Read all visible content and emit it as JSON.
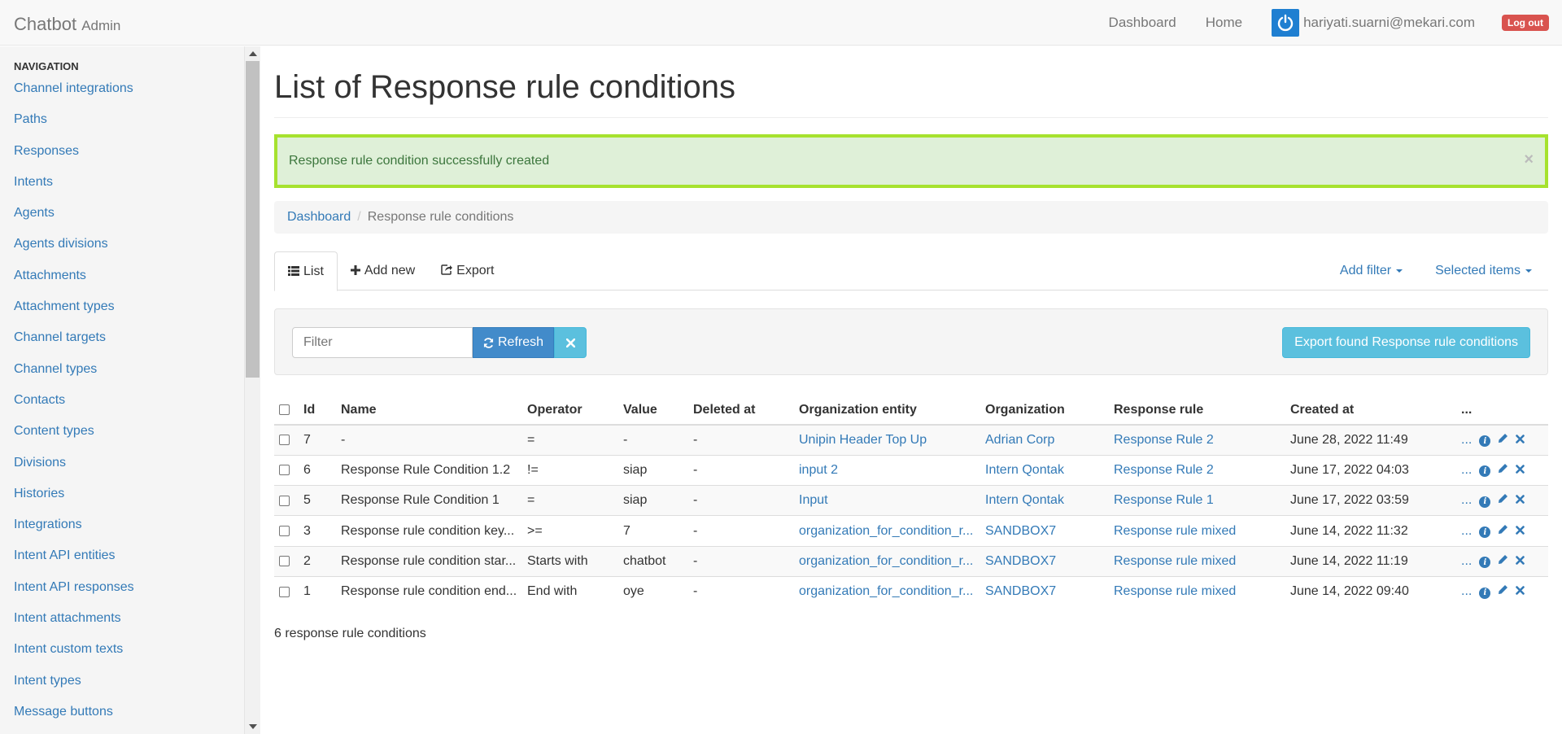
{
  "navbar": {
    "brand": "Chatbot",
    "brand_sub": "Admin",
    "links": [
      "Dashboard",
      "Home"
    ],
    "user_email": "hariyati.suarni@mekari.com",
    "logout_label": "Log out"
  },
  "sidebar": {
    "header": "NAVIGATION",
    "items": [
      "Channel integrations",
      "Paths",
      "Responses",
      "Intents",
      "Agents",
      "Agents divisions",
      "Attachments",
      "Attachment types",
      "Channel targets",
      "Channel types",
      "Contacts",
      "Content types",
      "Divisions",
      "Histories",
      "Integrations",
      "Intent API entities",
      "Intent API responses",
      "Intent attachments",
      "Intent custom texts",
      "Intent types",
      "Message buttons"
    ]
  },
  "page": {
    "title": "List of Response rule conditions",
    "alert": "Response rule condition successfully created",
    "alert_close": "×",
    "breadcrumb": [
      "Dashboard",
      "Response rule conditions"
    ],
    "breadcrumb_sep": "/",
    "tabs": [
      "List",
      "Add new",
      "Export"
    ],
    "add_filter": "Add filter",
    "selected_items": "Selected items",
    "filter_placeholder": "Filter",
    "refresh_label": "Refresh",
    "export_found_label": "Export found Response rule conditions",
    "footer_count": "6 response rule conditions"
  },
  "table": {
    "headers": [
      "Id",
      "Name",
      "Operator",
      "Value",
      "Deleted at",
      "Organization entity",
      "Organization",
      "Response rule",
      "Created at",
      "..."
    ],
    "rows": [
      {
        "id": "7",
        "name": "-",
        "operator": "=",
        "value": "-",
        "deleted_at": "-",
        "org_entity": "Unipin Header Top Up",
        "organization": "Adrian Corp",
        "response_rule": "Response Rule 2",
        "created_at": "June 28, 2022 11:49",
        "more": "..."
      },
      {
        "id": "6",
        "name": "Response Rule Condition 1.2",
        "operator": "!=",
        "value": "siap",
        "deleted_at": "-",
        "org_entity": "input 2",
        "organization": "Intern Qontak",
        "response_rule": "Response Rule 2",
        "created_at": "June 17, 2022 04:03",
        "more": "..."
      },
      {
        "id": "5",
        "name": "Response Rule Condition 1",
        "operator": "=",
        "value": "siap",
        "deleted_at": "-",
        "org_entity": "Input",
        "organization": "Intern Qontak",
        "response_rule": "Response Rule 1",
        "created_at": "June 17, 2022 03:59",
        "more": "..."
      },
      {
        "id": "3",
        "name": "Response rule condition key...",
        "operator": ">=",
        "value": "7",
        "deleted_at": "-",
        "org_entity": "organization_for_condition_r...",
        "organization": "SANDBOX7",
        "response_rule": "Response rule mixed",
        "created_at": "June 14, 2022 11:32",
        "more": "..."
      },
      {
        "id": "2",
        "name": "Response rule condition star...",
        "operator": "Starts with",
        "value": "chatbot",
        "deleted_at": "-",
        "org_entity": "organization_for_condition_r...",
        "organization": "SANDBOX7",
        "response_rule": "Response rule mixed",
        "created_at": "June 14, 2022 11:19",
        "more": "..."
      },
      {
        "id": "1",
        "name": "Response rule condition end...",
        "operator": "End with",
        "value": "oye",
        "deleted_at": "-",
        "org_entity": "organization_for_condition_r...",
        "organization": "SANDBOX7",
        "response_rule": "Response rule mixed",
        "created_at": "June 14, 2022 09:40",
        "more": "..."
      }
    ]
  }
}
